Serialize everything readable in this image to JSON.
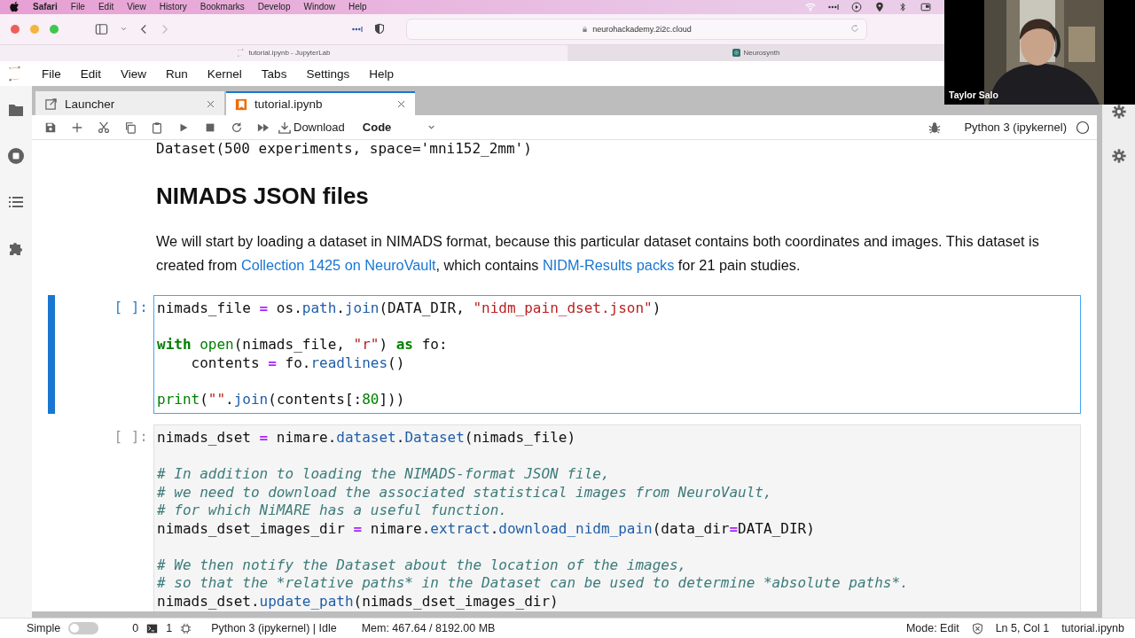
{
  "mac_menubar": {
    "app": "Safari",
    "items": [
      "File",
      "Edit",
      "View",
      "History",
      "Bookmarks",
      "Develop",
      "Window",
      "Help"
    ]
  },
  "browser": {
    "address": "neurohackademy.2i2c.cloud",
    "tabs": [
      {
        "label": "tutorial.ipynb - JupyterLab",
        "selected": true
      },
      {
        "label": "Neurosynth",
        "selected": false
      }
    ]
  },
  "video": {
    "name": "Taylor Salo"
  },
  "jupyter": {
    "menu": [
      "File",
      "Edit",
      "View",
      "Run",
      "Kernel",
      "Tabs",
      "Settings",
      "Help"
    ],
    "tabs": [
      {
        "label": "Launcher",
        "selected": false
      },
      {
        "label": "tutorial.ipynb",
        "selected": true
      }
    ],
    "toolbar": {
      "download": "Download",
      "cell_type": "Code",
      "kernel": "Python 3 (ipykernel)"
    }
  },
  "notebook": {
    "output": "Dataset(500 experiments, space='mni152_2mm')",
    "heading": "NIMADS JSON files",
    "paragraph": [
      {
        "text": "We will start by loading a dataset in NIMADS format, because this particular dataset contains both coordinates and images. This dataset is created from ",
        "link": false
      },
      {
        "text": "Collection 1425 on NeuroVault",
        "link": true
      },
      {
        "text": ", which contains ",
        "link": false
      },
      {
        "text": "NIDM-Results packs",
        "link": true
      },
      {
        "text": " for 21 pain studies.",
        "link": false
      }
    ],
    "cells": [
      {
        "prompt": "[ ]:",
        "selected": true,
        "lines": [
          {
            "gap_before": false,
            "tokens": [
              {
                "t": "nimads_file ",
                "kind": "plain"
              },
              {
                "t": "=",
                "kind": "op"
              },
              {
                "t": " os.",
                "kind": "plain"
              },
              {
                "t": "path",
                "kind": "attr"
              },
              {
                "t": ".",
                "kind": "plain"
              },
              {
                "t": "join",
                "kind": "attr"
              },
              {
                "t": "(DATA_DIR, ",
                "kind": "plain"
              },
              {
                "t": "\"nidm_pain_dset.json\"",
                "kind": "str"
              },
              {
                "t": ")",
                "kind": "plain"
              }
            ]
          },
          {
            "gap_before": true,
            "tokens": [
              {
                "t": "with",
                "kind": "kw"
              },
              {
                "t": " open",
                "kind": "builtin"
              },
              {
                "t": "(nimads_file, ",
                "kind": "plain"
              },
              {
                "t": "\"r\"",
                "kind": "str"
              },
              {
                "t": ") ",
                "kind": "plain"
              },
              {
                "t": "as",
                "kind": "kw"
              },
              {
                "t": " fo:",
                "kind": "plain"
              }
            ]
          },
          {
            "gap_before": false,
            "tokens": [
              {
                "t": "    contents ",
                "kind": "plain"
              },
              {
                "t": "=",
                "kind": "op"
              },
              {
                "t": " fo.",
                "kind": "plain"
              },
              {
                "t": "readlines",
                "kind": "attr"
              },
              {
                "t": "()",
                "kind": "plain"
              }
            ]
          },
          {
            "gap_before": true,
            "tokens": [
              {
                "t": "print",
                "kind": "builtin"
              },
              {
                "t": "(",
                "kind": "plain"
              },
              {
                "t": "\"\"",
                "kind": "str"
              },
              {
                "t": ".",
                "kind": "plain"
              },
              {
                "t": "join",
                "kind": "attr"
              },
              {
                "t": "(contents[:",
                "kind": "plain"
              },
              {
                "t": "80",
                "kind": "num"
              },
              {
                "t": "]))",
                "kind": "plain"
              }
            ]
          }
        ]
      },
      {
        "prompt": "[ ]:",
        "selected": false,
        "lines": [
          {
            "gap_before": false,
            "tokens": [
              {
                "t": "nimads_dset ",
                "kind": "plain"
              },
              {
                "t": "=",
                "kind": "op"
              },
              {
                "t": " nimare.",
                "kind": "plain"
              },
              {
                "t": "dataset",
                "kind": "attr"
              },
              {
                "t": ".",
                "kind": "plain"
              },
              {
                "t": "Dataset",
                "kind": "attr"
              },
              {
                "t": "(nimads_file)",
                "kind": "plain"
              }
            ]
          },
          {
            "gap_before": true,
            "tokens": [
              {
                "t": "# In addition to loading the NIMADS-format JSON file,",
                "kind": "comment"
              }
            ]
          },
          {
            "gap_before": false,
            "tokens": [
              {
                "t": "# we need to download the associated statistical images from NeuroVault,",
                "kind": "comment"
              }
            ]
          },
          {
            "gap_before": false,
            "tokens": [
              {
                "t": "# for which NiMARE has a useful function.",
                "kind": "comment"
              }
            ]
          },
          {
            "gap_before": false,
            "tokens": [
              {
                "t": "nimads_dset_images_dir ",
                "kind": "plain"
              },
              {
                "t": "=",
                "kind": "op"
              },
              {
                "t": " nimare.",
                "kind": "plain"
              },
              {
                "t": "extract",
                "kind": "attr"
              },
              {
                "t": ".",
                "kind": "plain"
              },
              {
                "t": "download_nidm_pain",
                "kind": "attr"
              },
              {
                "t": "(data_dir",
                "kind": "plain"
              },
              {
                "t": "=",
                "kind": "op"
              },
              {
                "t": "DATA_DIR)",
                "kind": "plain"
              }
            ]
          },
          {
            "gap_before": true,
            "tokens": [
              {
                "t": "# We then notify the Dataset about the location of the images,",
                "kind": "comment"
              }
            ]
          },
          {
            "gap_before": false,
            "tokens": [
              {
                "t": "# so that the *relative paths* in the Dataset can be used to determine *absolute paths*.",
                "kind": "comment"
              }
            ]
          },
          {
            "gap_before": false,
            "tokens": [
              {
                "t": "nimads_dset.",
                "kind": "plain"
              },
              {
                "t": "update_path",
                "kind": "attr"
              },
              {
                "t": "(nimads_dset_images_dir)",
                "kind": "plain"
              }
            ]
          }
        ]
      }
    ]
  },
  "status_bar": {
    "simple": {
      "label": "Simple",
      "on": false
    },
    "terminals": "0",
    "kernels": "1",
    "kernel_status": "Python 3 (ipykernel) | Idle",
    "memory": "Mem: 467.64 / 8192.00 MB",
    "mode": "Mode: Edit",
    "position": "Ln 5, Col 1",
    "file": "tutorial.ipynb"
  }
}
